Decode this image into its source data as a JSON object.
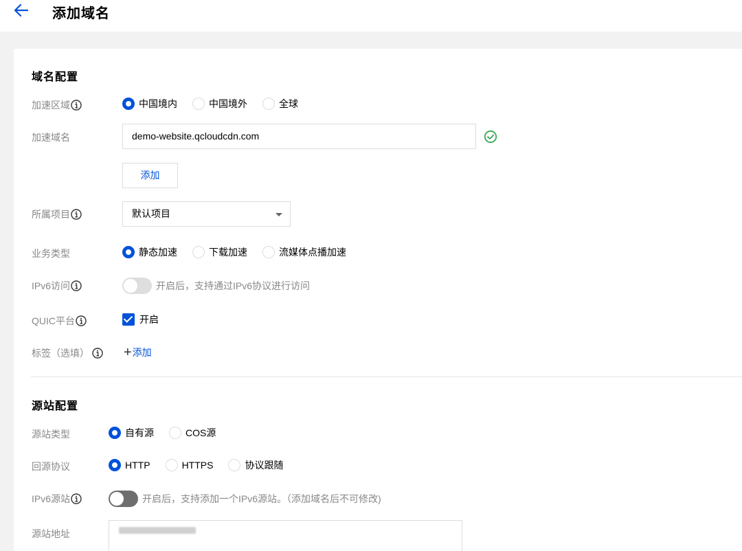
{
  "header": {
    "title": "添加域名"
  },
  "domain_config": {
    "section_title": "域名配置",
    "accel_region": {
      "label": "加速区域",
      "options": [
        "中国境内",
        "中国境外",
        "全球"
      ],
      "selected": 0
    },
    "accel_domain": {
      "label": "加速域名",
      "value": "demo-website.qcloudcdn.com"
    },
    "add_button": "添加",
    "project": {
      "label": "所属项目",
      "value": "默认项目"
    },
    "business_type": {
      "label": "业务类型",
      "options": [
        "静态加速",
        "下载加速",
        "流媒体点播加速"
      ],
      "selected": 0
    },
    "ipv6_access": {
      "label": "IPv6访问",
      "hint": "开启后，支持通过IPv6协议进行访问"
    },
    "quic": {
      "label": "QUIC平台",
      "checkbox_label": "开启"
    },
    "tags": {
      "label": "标签（选填）",
      "add_label": "添加"
    }
  },
  "origin_config": {
    "section_title": "源站配置",
    "origin_type": {
      "label": "源站类型",
      "options": [
        "自有源",
        "COS源"
      ],
      "selected": 0
    },
    "origin_protocol": {
      "label": "回源协议",
      "options": [
        "HTTP",
        "HTTPS",
        "协议跟随"
      ],
      "selected": 0
    },
    "ipv6_origin": {
      "label": "IPv6源站",
      "hint": "开启后，支持添加一个IPv6源站。（添加域名后不可修改)"
    },
    "origin_address": {
      "label": "源站地址"
    }
  },
  "colors": {
    "primary": "#0052d9",
    "success": "#34a853"
  }
}
